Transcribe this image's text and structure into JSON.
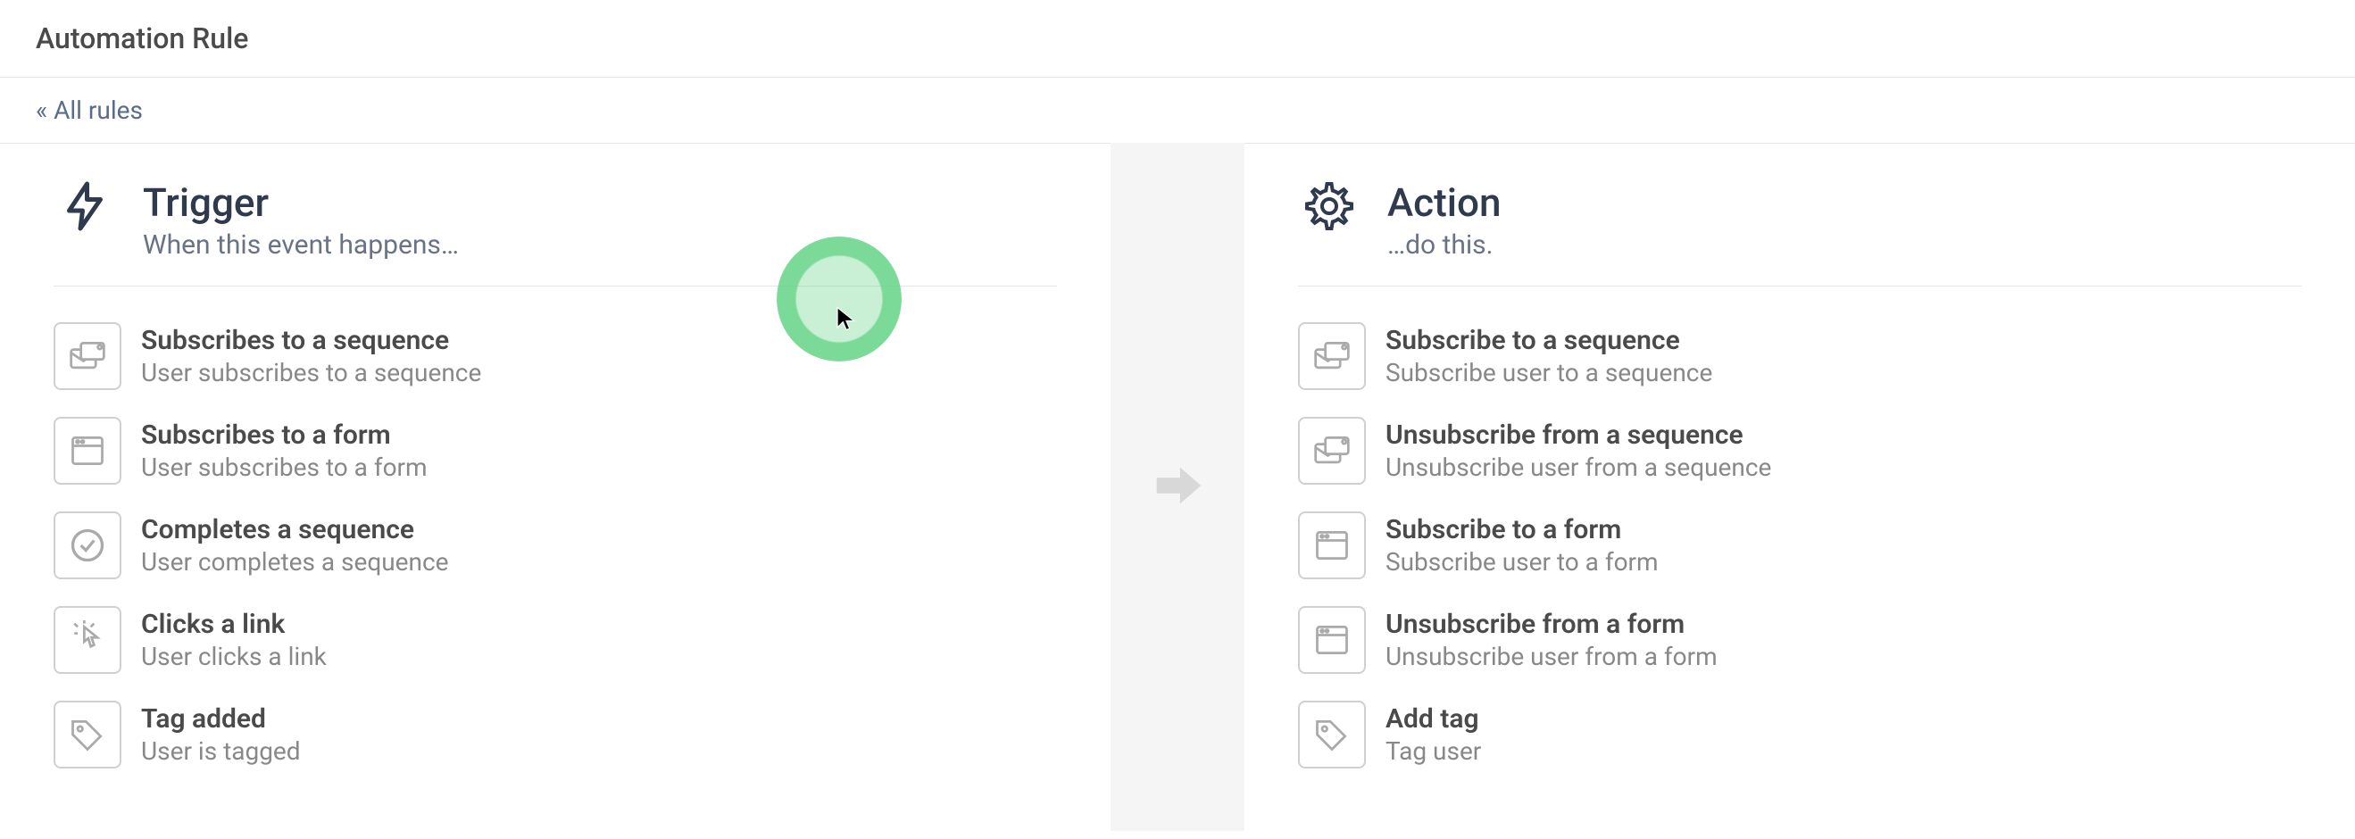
{
  "header": {
    "title": "Automation Rule"
  },
  "breadcrumb": {
    "all_rules": "« All rules"
  },
  "trigger": {
    "title": "Trigger",
    "subtitle": "When this event happens…",
    "options": [
      {
        "icon": "mail-stack-icon",
        "title": "Subscribes to a sequence",
        "desc": "User subscribes to a sequence"
      },
      {
        "icon": "form-icon",
        "title": "Subscribes to a form",
        "desc": "User subscribes to a form"
      },
      {
        "icon": "check-circle-icon",
        "title": "Completes a sequence",
        "desc": "User completes a sequence"
      },
      {
        "icon": "click-icon",
        "title": "Clicks a link",
        "desc": "User clicks a link"
      },
      {
        "icon": "tag-icon",
        "title": "Tag added",
        "desc": "User is tagged"
      }
    ]
  },
  "action": {
    "title": "Action",
    "subtitle": "…do this.",
    "options": [
      {
        "icon": "mail-stack-icon",
        "title": "Subscribe to a sequence",
        "desc": "Subscribe user to a sequence"
      },
      {
        "icon": "mail-stack-icon",
        "title": "Unsubscribe from a sequence",
        "desc": "Unsubscribe user from a sequence"
      },
      {
        "icon": "form-icon",
        "title": "Subscribe to a form",
        "desc": "Subscribe user to a form"
      },
      {
        "icon": "form-icon",
        "title": "Unsubscribe from a form",
        "desc": "Unsubscribe user from a form"
      },
      {
        "icon": "tag-icon",
        "title": "Add tag",
        "desc": "Tag user"
      }
    ]
  }
}
